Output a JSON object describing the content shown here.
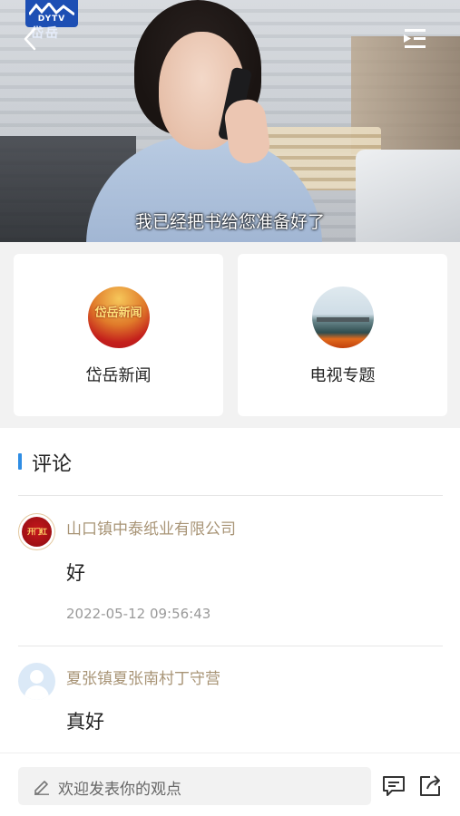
{
  "video": {
    "logo_text": "DYTV",
    "logo_sub": "岱岳",
    "subtitle": "我已经把书给您准备好了"
  },
  "categories": [
    {
      "label": "岱岳新闻",
      "thumb_text": "岱岳新闻"
    },
    {
      "label": "电视专题"
    }
  ],
  "comments": {
    "title": "评论",
    "items": [
      {
        "name": "山口镇中泰纸业有限公司",
        "text": "好",
        "time": "2022-05-12 09:56:43",
        "avatar_text": "开门红"
      },
      {
        "name": "夏张镇夏张南村丁守营",
        "text": "真好"
      }
    ]
  },
  "bottom": {
    "placeholder": "欢迎发表你的观点"
  },
  "colors": {
    "accent": "#2f8de4",
    "name": "#a89476",
    "time": "#9a9a9a"
  },
  "icons": [
    "back-icon",
    "playlist-icon",
    "pencil-icon",
    "comment-icon",
    "share-icon"
  ]
}
